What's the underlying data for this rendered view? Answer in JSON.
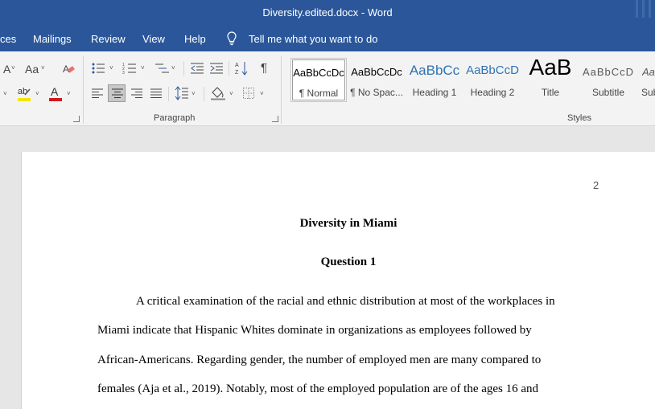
{
  "window": {
    "title": "Diversity.edited.docx  -  Word"
  },
  "menu": {
    "items": [
      "ces",
      "Mailings",
      "Review",
      "View",
      "Help"
    ],
    "tell_me": "Tell me what you want to do"
  },
  "ribbon": {
    "font_group": {
      "font_size_icon": "A",
      "change_case": "Aa"
    },
    "paragraph_group": {
      "label": "Paragraph",
      "selected_alignment": "center"
    },
    "styles_group": {
      "label": "Styles",
      "items": [
        {
          "preview": "AaBbCcDc",
          "name": "¶ Normal",
          "selected": true
        },
        {
          "preview": "AaBbCcDc",
          "name": "¶ No Spac..."
        },
        {
          "preview": "AaBbCc",
          "name": "Heading 1"
        },
        {
          "preview": "AaBbCcD",
          "name": "Heading 2"
        },
        {
          "preview": "AaB",
          "name": "Title"
        },
        {
          "preview": "AaBbCcD",
          "name": "Subtitle"
        },
        {
          "preview": "Aa",
          "name": "Sub"
        }
      ]
    },
    "colors": {
      "highlight": "#f2e600",
      "font_color": "#d0191c"
    }
  },
  "document": {
    "page_number": "2",
    "title": "Diversity in Miami",
    "subheading": "Question 1",
    "paragraph_lines": [
      "A critical examination of the racial and ethnic distribution at most of the workplaces in",
      "Miami indicate that Hispanic Whites dominate in organizations as employees followed by",
      "African-Americans. Regarding gender, the number of employed men are many compared to",
      "females (Aja et al., 2019). Notably, most of the employed population are of the ages 16 and"
    ]
  },
  "theme": {
    "accent": "#2b579a"
  }
}
